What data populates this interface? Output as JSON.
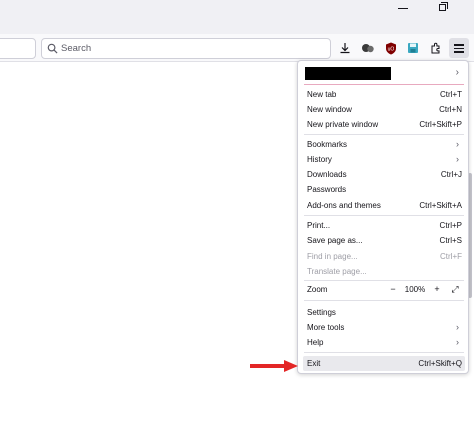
{
  "toolbar": {
    "search_placeholder": "Search",
    "icons": [
      "download-icon",
      "extension-puzzle-icon",
      "ublock-icon",
      "save-icon",
      "extensions-icon",
      "hamburger-menu-icon"
    ]
  },
  "menu": {
    "profile_chevron": "›",
    "items": [
      {
        "label": "New tab",
        "shortcut": "Ctrl+T"
      },
      {
        "label": "New window",
        "shortcut": "Ctrl+N"
      },
      {
        "label": "New private window",
        "shortcut": "Ctrl+Skift+P"
      },
      {
        "label": "Bookmarks",
        "arrow": "›"
      },
      {
        "label": "History",
        "arrow": "›"
      },
      {
        "label": "Downloads",
        "shortcut": "Ctrl+J"
      },
      {
        "label": "Passwords"
      },
      {
        "label": "Add-ons and themes",
        "shortcut": "Ctrl+Skift+A"
      },
      {
        "label": "Print...",
        "shortcut": "Ctrl+P"
      },
      {
        "label": "Save page as...",
        "shortcut": "Ctrl+S"
      },
      {
        "label": "Find in page...",
        "shortcut": "Ctrl+F"
      },
      {
        "label": "Translate page..."
      },
      {
        "label": "Zoom",
        "zoom_minus": "−",
        "zoom_value": "100%",
        "zoom_plus": "+",
        "fullscreen": "⤢"
      },
      {
        "label": "Settings"
      },
      {
        "label": "More tools",
        "arrow": "›"
      },
      {
        "label": "Help",
        "arrow": "›"
      },
      {
        "label": "Exit",
        "shortcut": "Ctrl+Skift+Q"
      }
    ]
  },
  "colors": {
    "annotation_arrow": "#e32626",
    "hover_bg": "#e9e9ed",
    "profile_underline": "#e8a9bf"
  }
}
